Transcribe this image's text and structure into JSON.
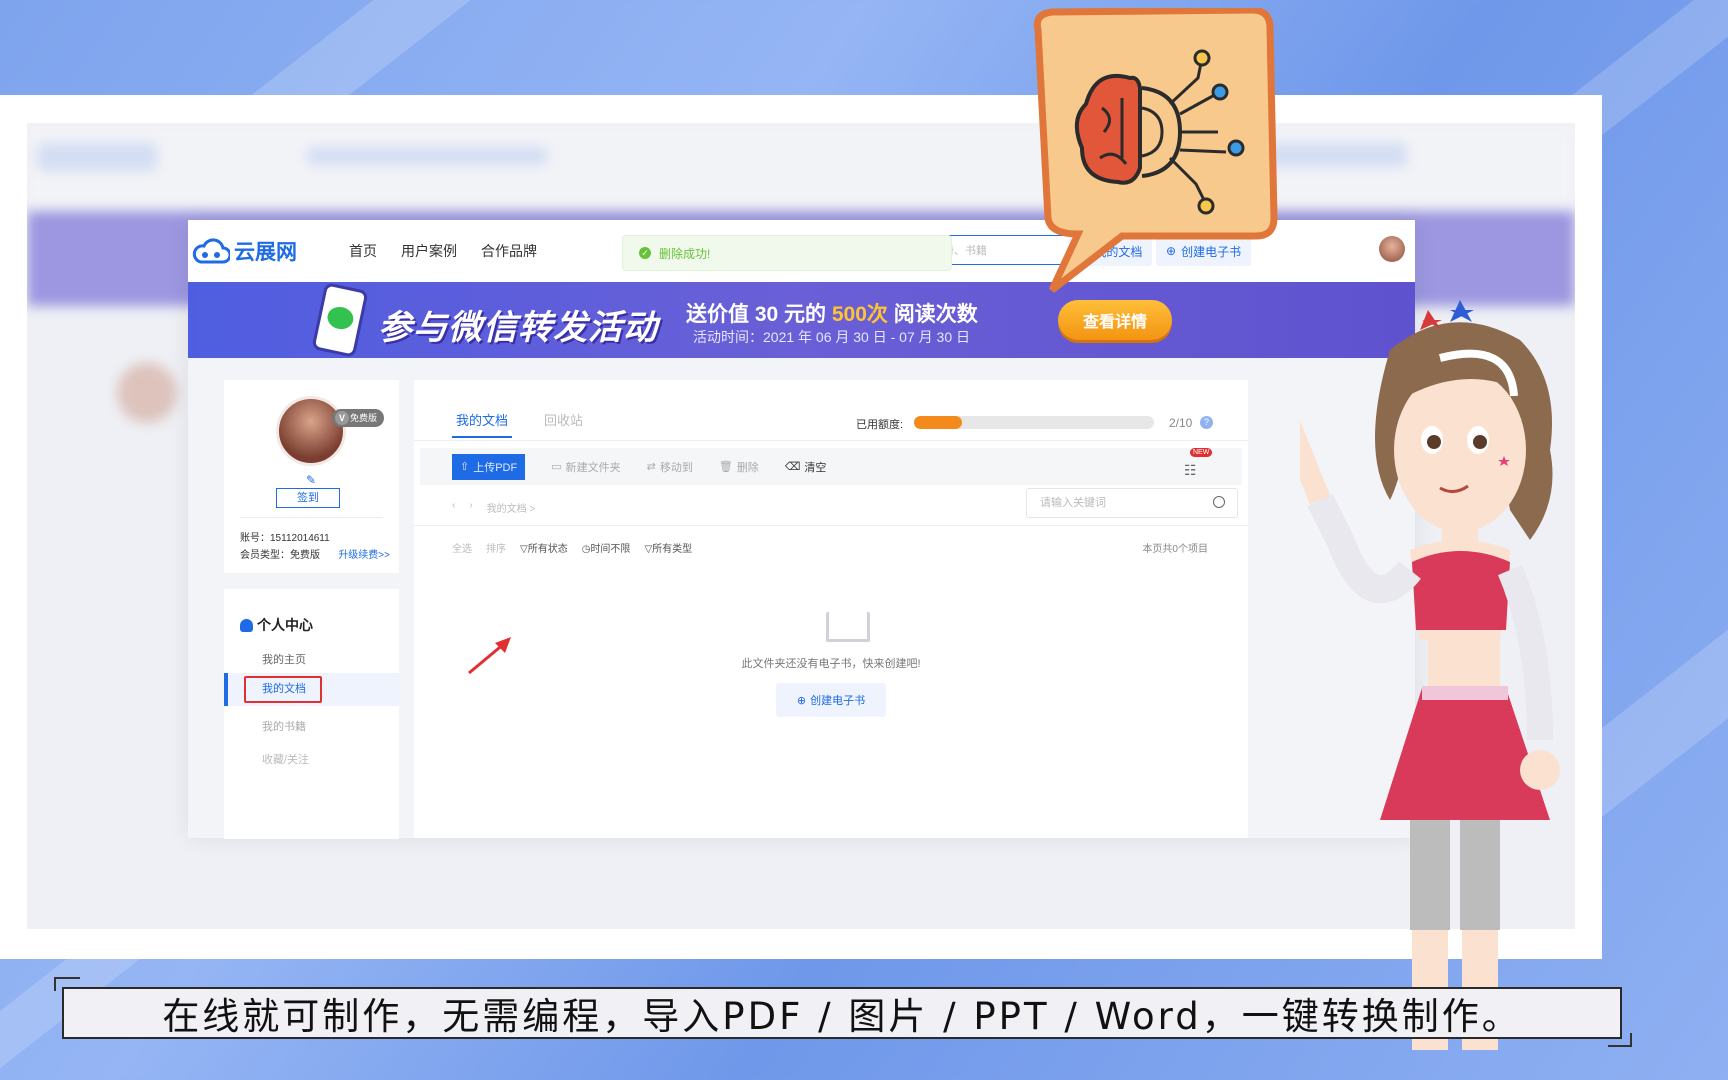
{
  "site": {
    "logo_text": "云展网",
    "nav_links": [
      "首页",
      "用户案例",
      "合作品牌"
    ],
    "toast": "删除成功!",
    "search_placeholder": "杂志、画册、书籍",
    "my_docs_btn": "我的文档",
    "create_ebook_btn": "创建电子书"
  },
  "banner": {
    "title": "参与微信转发活动",
    "main_pre": "送价值 30 元的 ",
    "main_highlight": "500次",
    "main_post": " 阅读次数",
    "sub": "活动时间：2021 年 06 月 30 日 - 07 月 30 日",
    "button": "查看详情"
  },
  "profile": {
    "badge": "免费版",
    "signin": "签到",
    "account": "账号：15112014611",
    "member_type": "会员类型：免费版",
    "upgrade": "升级续费>>"
  },
  "menu": {
    "heading": "个人中心",
    "items": [
      "我的主页",
      "我的文档",
      "我的书籍",
      "收藏/关注"
    ]
  },
  "main": {
    "tab_docs": "我的文档",
    "tab_recycle": "回收站",
    "quota_label": "已用额度:",
    "quota_used": 2,
    "quota_total": 10,
    "quota_text": "2/10",
    "new_badge": "NEW",
    "toolbar": {
      "upload": "上传PDF",
      "new_folder": "新建文件夹",
      "move": "移动到",
      "delete": "删除",
      "clear": "清空"
    },
    "path": "我的文档 >",
    "keyword_placeholder": "请输入关键词",
    "filters": {
      "all": "全选",
      "sort": "排序",
      "status": "所有状态",
      "time": "时间不限",
      "type": "所有类型"
    },
    "count": "本页共0个项目",
    "empty_text": "此文件夹还没有电子书，快来创建吧!",
    "create_btn": "创建电子书"
  },
  "caption": "在线就可制作，无需编程，导入PDF / 图片 / PPT / Word，一键转换制作。",
  "colors": {
    "brand": "#1e6be5",
    "accent_orange": "#f58a1c",
    "highlight_red": "#e23030",
    "banner_purple": "#5f52cf"
  }
}
